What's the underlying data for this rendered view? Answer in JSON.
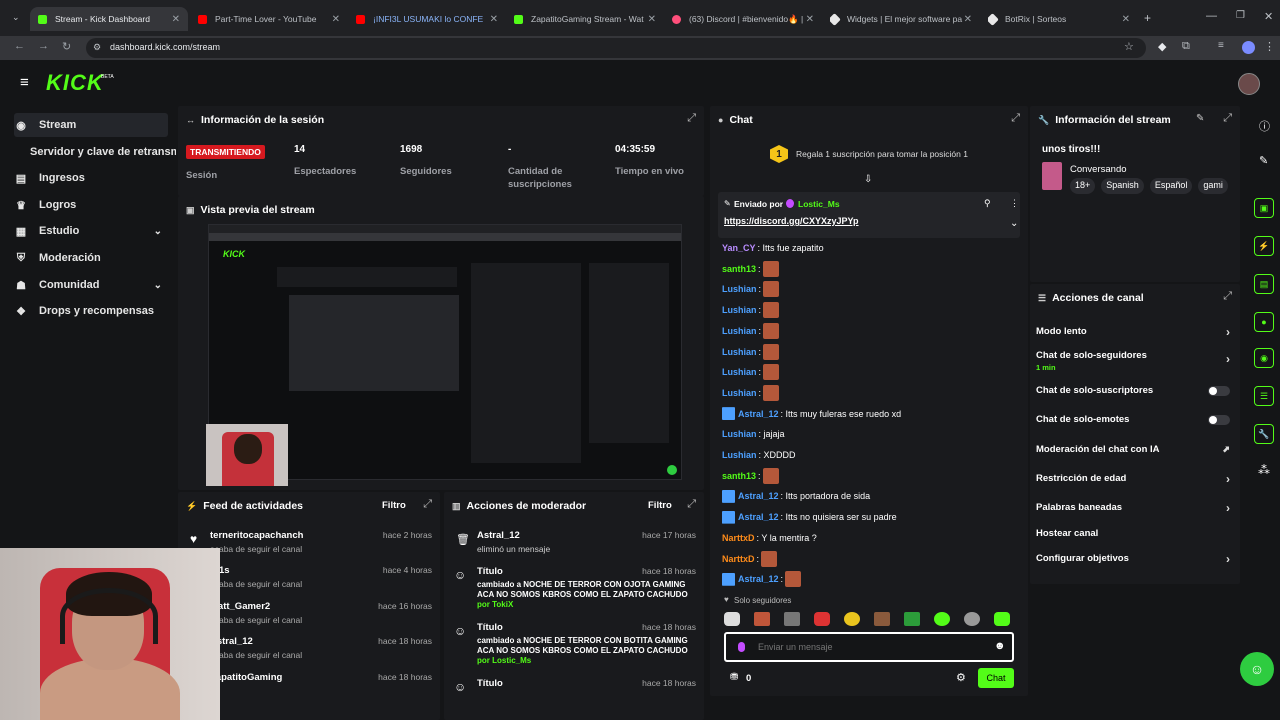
{
  "browser": {
    "tabs": [
      {
        "title": "Stream - Kick Dashboard",
        "color": "#53fc18",
        "active": true
      },
      {
        "title": "Part-Time Lover - YouTube",
        "color": "#ff0000"
      },
      {
        "title": "¡INFI3L USUMAKI lo CONFE",
        "color": "#ff0000"
      },
      {
        "title": "ZapatitoGaming Stream - Wat",
        "color": "#53fc18"
      },
      {
        "title": "(63) Discord | #bienvenido🔥 |",
        "color": "#ff4f7b"
      },
      {
        "title": "Widgets | El mejor software pa",
        "color": "#e8e8e8"
      },
      {
        "title": "BotRix | Sorteos",
        "color": "#e8e8e8"
      }
    ],
    "url": "dashboard.kick.com/stream"
  },
  "brand": {
    "logo": "KICK",
    "beta": "BETA",
    "accent": "#53fc18"
  },
  "sidebar": {
    "items": [
      {
        "label": "Stream",
        "icon": "stream-icon"
      },
      {
        "label": "Servidor y clave de retransm"
      },
      {
        "label": "Ingresos",
        "icon": "money-icon"
      },
      {
        "label": "Logros",
        "icon": "trophy-icon"
      },
      {
        "label": "Estudio",
        "icon": "studio-icon",
        "chevron": true
      },
      {
        "label": "Moderación",
        "icon": "shield-icon"
      },
      {
        "label": "Comunidad",
        "icon": "community-icon",
        "chevron": true
      },
      {
        "label": "Drops y recompensas",
        "icon": "gift-icon"
      }
    ]
  },
  "session": {
    "title": "Información de la sesión",
    "badge": "TRANSMITIENDO",
    "badge_label": "Sesión",
    "stats": [
      {
        "value": "14",
        "label": "Espectadores"
      },
      {
        "value": "1698",
        "label": "Seguidores"
      },
      {
        "value": "-",
        "label": "Cantidad de suscripciones"
      },
      {
        "value": "04:35:59",
        "label": "Tiempo en vivo"
      }
    ]
  },
  "preview": {
    "title": "Vista previa del stream"
  },
  "feed": {
    "title": "Feed de actividades",
    "filter": "Filtro",
    "items": [
      {
        "name": "terneritocapachanch",
        "sub": "acaba de seguir el canal",
        "time": "hace 2 horas"
      },
      {
        "name": "cr1s",
        "sub": "acaba de seguir el canal",
        "time": "hace 4 horas"
      },
      {
        "name": "Matt_Gamer2",
        "sub": "acaba de seguir el canal",
        "time": "hace 16 horas"
      },
      {
        "name": "Astral_12",
        "sub": "acaba de seguir el canal",
        "time": "hace 18 horas"
      },
      {
        "name": "ZapatitoGaming",
        "sub": "",
        "time": "hace 18 horas"
      }
    ]
  },
  "modactions": {
    "title": "Acciones de moderador",
    "filter": "Filtro",
    "items": [
      {
        "name": "Astral_12",
        "line1": "eliminó un mensaje",
        "line2": "",
        "by": "",
        "time": "hace 17 horas"
      },
      {
        "name": "Título",
        "line1": "cambiado a NOCHE DE TERROR CON OJOTA GAMING",
        "line2": "ACA NO SOMOS KBROS COMO EL ZAPATO CACHUDO",
        "by": "por TokiX",
        "time": "hace 18 horas"
      },
      {
        "name": "Título",
        "line1": "cambiado a NOCHE DE TERROR CON BOTITA GAMING",
        "line2": "ACA NO SOMOS KBROS COMO EL ZAPATO CACHUDO",
        "by": "por Lostic_Ms",
        "time": "hace 18 horas"
      },
      {
        "name": "Título",
        "line1": "",
        "line2": "",
        "by": "",
        "time": "hace 18 horas"
      }
    ]
  },
  "chat": {
    "title": "Chat",
    "gift_count": "1",
    "gift_text": "Regala 1 suscripción para tomar la posición 1",
    "pinned_by_label": "Enviado por",
    "pinned_by": "Lostic_Ms",
    "pinned_link": "https://discord.gg/CXYXzyJPYp",
    "messages": [
      {
        "user": "Yan_CY",
        "color": "#b98cff",
        "text": ": Itts fue zapatito",
        "emote": false
      },
      {
        "user": "santh13",
        "color": "#53fc18",
        "text": ":",
        "emote": true
      },
      {
        "user": "Lushian",
        "color": "#4da0ff",
        "text": ":",
        "emote": true
      },
      {
        "user": "Lushian",
        "color": "#4da0ff",
        "text": ":",
        "emote": true
      },
      {
        "user": "Lushian",
        "color": "#4da0ff",
        "text": ":",
        "emote": true
      },
      {
        "user": "Lushian",
        "color": "#4da0ff",
        "text": ":",
        "emote": true
      },
      {
        "user": "Lushian",
        "color": "#4da0ff",
        "text": ":",
        "emote": true
      },
      {
        "user": "Lushian",
        "color": "#4da0ff",
        "text": ":",
        "emote": true
      },
      {
        "user": "Astral_12",
        "color": "#4da0ff",
        "text": ": Itts muy fuleras ese ruedo xd",
        "emote": false,
        "badge": true
      },
      {
        "user": "Lushian",
        "color": "#4da0ff",
        "text": ": jajaja",
        "emote": false
      },
      {
        "user": "Lushian",
        "color": "#4da0ff",
        "text": ": XDDDD",
        "emote": false
      },
      {
        "user": "santh13",
        "color": "#53fc18",
        "text": ":",
        "emote": true
      },
      {
        "user": "Astral_12",
        "color": "#4da0ff",
        "text": ": Itts portadora de sida",
        "emote": false,
        "badge": true
      },
      {
        "user": "Astral_12",
        "color": "#4da0ff",
        "text": ": Itts no quisiera ser su padre",
        "emote": false,
        "badge": true
      },
      {
        "user": "NarttxD",
        "color": "#ff8c1a",
        "text": ": Y la mentira ?",
        "emote": false
      },
      {
        "user": "NarttxD",
        "color": "#ff8c1a",
        "text": ":",
        "emote": true
      },
      {
        "user": "Astral_12",
        "color": "#4da0ff",
        "text": ":",
        "emote": true,
        "badge": true
      }
    ],
    "followers_only": "Solo seguidores",
    "input_placeholder": "Enviar un mensaje",
    "points": "0",
    "send": "Chat"
  },
  "streaminfo": {
    "title": "Información del stream",
    "stream_title": "unos tiros!!!",
    "category": "Conversando",
    "tags": [
      "18+",
      "Spanish",
      "Español",
      "gami"
    ]
  },
  "channelactions": {
    "title": "Acciones de canal",
    "items": [
      {
        "label": "Modo lento",
        "control": "arrow"
      },
      {
        "label": "Chat de solo-seguidores",
        "sub": "1 min",
        "control": "arrow"
      },
      {
        "label": "Chat de solo-suscriptores",
        "control": "toggle"
      },
      {
        "label": "Chat de solo-emotes",
        "control": "toggle"
      },
      {
        "label": "Moderación del chat con IA",
        "control": "external"
      },
      {
        "label": "Restricción de edad",
        "control": "arrow"
      },
      {
        "label": "Palabras baneadas",
        "control": "arrow"
      },
      {
        "label": "Hostear canal",
        "control": "none"
      },
      {
        "label": "Configurar objetivos",
        "control": "arrow"
      }
    ]
  }
}
